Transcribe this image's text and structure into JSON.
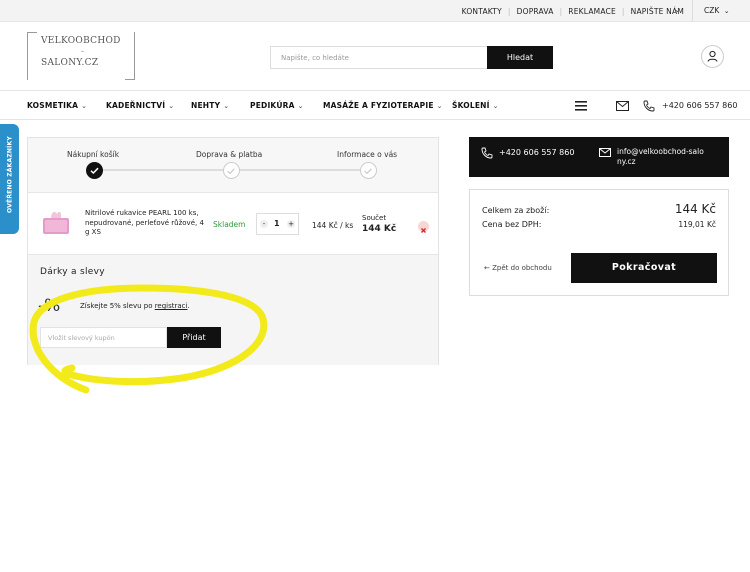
{
  "topbar": {
    "links": [
      "KONTAKTY",
      "DOPRAVA",
      "REKLAMACE",
      "NAPIŠTE NÁM"
    ],
    "currency": "CZK"
  },
  "logo": {
    "line1": "VELKOOBCHOD",
    "line2": "-",
    "line3": "SALONY.CZ"
  },
  "search": {
    "placeholder": "Napište, co hledáte",
    "button": "Hledat"
  },
  "nav": {
    "items": [
      "KOSMETIKA",
      "KADEŘNICTVÍ",
      "NEHTY",
      "PEDIKÚRA",
      "MASÁŽE A FYZIOTERAPIE",
      "ŠKOLENÍ"
    ],
    "phone": "+420 606 557 860"
  },
  "side_tab": {
    "label": "OVĚŘENO ZÁKAZNÍKY"
  },
  "steps": [
    "Nákupní košík",
    "Doprava & platba",
    "Informace o vás"
  ],
  "cart_item": {
    "name": "Nitrilové rukavice PEARL 100 ks, nepudrované, perleťové růžové, 4 g XS",
    "availability": "Skladem",
    "quantity": "1",
    "unit_price": "144 Kč / ks",
    "total_label": "Součet",
    "total": "144 Kč",
    "minus": "-",
    "plus": "+"
  },
  "gifts": {
    "title": "Dárky a slevy",
    "percent": "-%",
    "promo_text": "Získejte 5% slevu po ",
    "promo_link": "registraci",
    "promo_end": ".",
    "coupon_placeholder": "Vložit slevový kupón",
    "add_button": "Přidat"
  },
  "contact": {
    "phone": "+420 606 557 860",
    "email": "info@velkoobchod-salony.cz"
  },
  "summary": {
    "total_label": "Celkem za zboží:",
    "total": "144 Kč",
    "net_label": "Cena bez DPH:",
    "net": "119,01 Kč",
    "back": "Zpět do obchodu",
    "continue": "Pokračovat"
  },
  "colors": {
    "accent_green": "#2e9b3c",
    "highlight": "#f2ea1a",
    "side_tab": "#2b8fc9",
    "dark": "#111111"
  }
}
